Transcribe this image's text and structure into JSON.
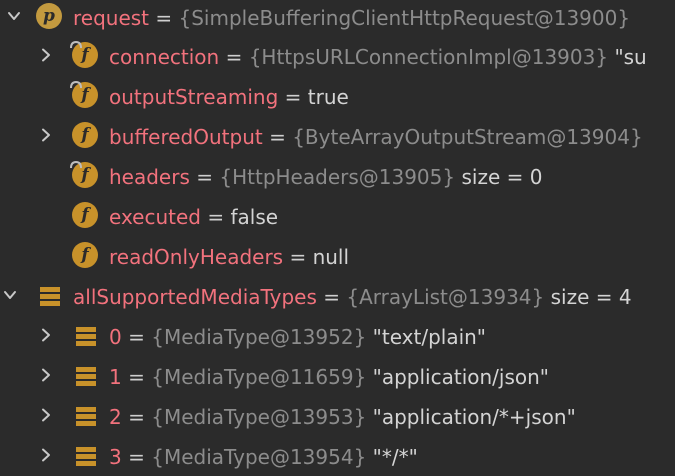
{
  "colors": {
    "background": "#2b2b2b",
    "field_name": "#f2727d",
    "type_ref": "#8c8c8c",
    "value": "#d4d4d4",
    "field_icon": "#c8922a"
  },
  "rows": [
    {
      "toggle": "expanded",
      "icon": "property-icon",
      "icon_letter": "p",
      "name": "request",
      "eq": "=",
      "type": "{SimpleBufferingClientHttpRequest@13900}",
      "value": ""
    },
    {
      "toggle": "collapsed",
      "icon": "field-icon",
      "icon_letter": "f",
      "locked": true,
      "name": "connection",
      "eq": "=",
      "type": "{HttpsURLConnectionImpl@13903}",
      "value": "\"su"
    },
    {
      "toggle": "none",
      "icon": "field-icon",
      "icon_letter": "f",
      "locked": true,
      "name": "outputStreaming",
      "eq": "=",
      "type": "",
      "value": "true"
    },
    {
      "toggle": "collapsed",
      "icon": "field-icon",
      "icon_letter": "f",
      "locked": false,
      "name": "bufferedOutput",
      "eq": "=",
      "type": "{ByteArrayOutputStream@13904}",
      "value": ""
    },
    {
      "toggle": "none",
      "icon": "field-icon",
      "icon_letter": "f",
      "locked": true,
      "name": "headers",
      "eq": "=",
      "type": "{HttpHeaders@13905}",
      "value": " size = 0"
    },
    {
      "toggle": "none",
      "icon": "field-icon",
      "icon_letter": "f",
      "locked": false,
      "name": "executed",
      "eq": "=",
      "type": "",
      "value": "false"
    },
    {
      "toggle": "none",
      "icon": "field-icon",
      "icon_letter": "f",
      "locked": false,
      "name": "readOnlyHeaders",
      "eq": "=",
      "type": "",
      "value": "null"
    },
    {
      "toggle": "expanded",
      "icon": "array-icon",
      "name": "allSupportedMediaTypes",
      "eq": "=",
      "type": "{ArrayList@13934}",
      "value": " size = 4"
    },
    {
      "toggle": "collapsed",
      "icon": "array-icon",
      "name": "0",
      "eq": "=",
      "type": "{MediaType@13952}",
      "value": "\"text/plain\""
    },
    {
      "toggle": "collapsed",
      "icon": "array-icon",
      "name": "1",
      "eq": "=",
      "type": "{MediaType@11659}",
      "value": "\"application/json\""
    },
    {
      "toggle": "collapsed",
      "icon": "array-icon",
      "name": "2",
      "eq": "=",
      "type": "{MediaType@13953}",
      "value": "\"application/*+json\""
    },
    {
      "toggle": "collapsed",
      "icon": "array-icon",
      "name": "3",
      "eq": "=",
      "type": "{MediaType@13954}",
      "value": "\"*/*\""
    }
  ]
}
